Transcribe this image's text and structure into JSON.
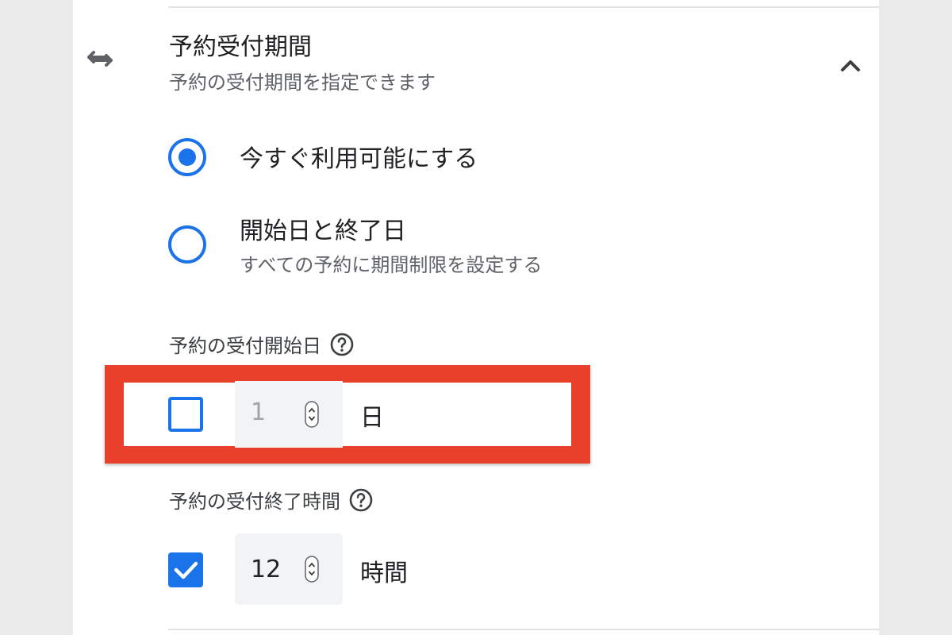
{
  "section": {
    "title": "予約受付期間",
    "subtitle": "予約の受付期間を指定できます",
    "leading_icon": "swap-horiz-icon",
    "collapse_icon": "chevron-up-icon"
  },
  "availability_options": [
    {
      "label": "今すぐ利用可能にする",
      "description": "",
      "selected": true
    },
    {
      "label": "開始日と終了日",
      "description": "すべての予約に期間制限を設定する",
      "selected": false
    }
  ],
  "booking_start": {
    "label": "予約の受付開始日",
    "help_icon": "help-circle-icon",
    "enabled": false,
    "value": "1",
    "unit": "日"
  },
  "booking_end": {
    "label": "予約の受付終了時間",
    "help_icon": "help-circle-icon",
    "enabled": true,
    "value": "12",
    "unit": "時間"
  },
  "colors": {
    "accent": "#1a73e8",
    "highlight": "#e8402b",
    "text_primary": "#202124",
    "text_secondary": "#5f6368",
    "background": "#eaeaea",
    "panel": "#ffffff"
  }
}
